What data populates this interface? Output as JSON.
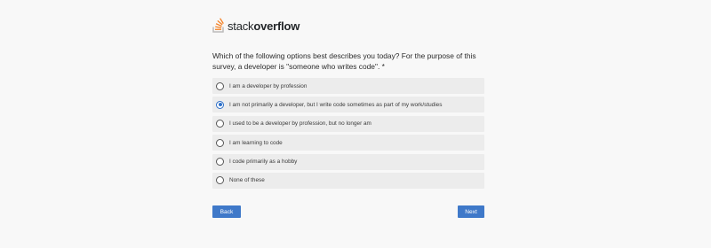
{
  "brand": {
    "name_light": "stack",
    "name_bold": "overflow",
    "icon": "stackoverflow-logo-icon",
    "colors": {
      "logo_orange": "#f48024",
      "logo_gray": "#bcbbbb",
      "accent_blue": "#3f79c9"
    }
  },
  "survey": {
    "question": "Which of the following options best describes you today? For the purpose of this survey, a developer is \"someone who writes code\". *",
    "options": [
      {
        "label": "I am a developer by profession",
        "selected": false
      },
      {
        "label": "I am not primarily a developer, but I write code sometimes as part of my work/studies",
        "selected": true
      },
      {
        "label": "I used to be a developer by profession, but no longer am",
        "selected": false
      },
      {
        "label": "I am learning to code",
        "selected": false
      },
      {
        "label": "I code primarily as a hobby",
        "selected": false
      },
      {
        "label": "None of these",
        "selected": false
      }
    ]
  },
  "navigation": {
    "back_label": "Back",
    "next_label": "Next"
  }
}
